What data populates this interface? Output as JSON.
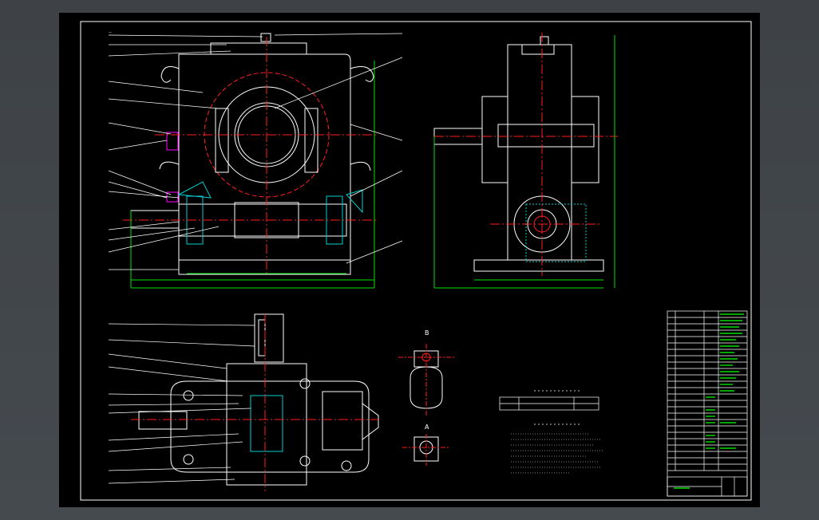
{
  "drawing": {
    "title": "",
    "view_labels": {
      "section_b": "B",
      "section_a": "A"
    },
    "colors": {
      "background": "#000000",
      "frame": "#ffffff",
      "part_line": "#ffffff",
      "center_line": "#ff2020",
      "dimension": "#00e000",
      "hatch": "#00d0d0",
      "highlight": "#ff00ff"
    },
    "tech_table_title": "",
    "tech_req_title": ""
  }
}
